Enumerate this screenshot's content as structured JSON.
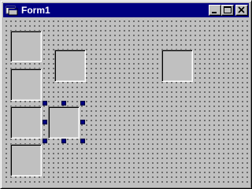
{
  "window": {
    "title": "Form1",
    "icon": "form-icon",
    "caption_buttons": [
      "minimize-icon",
      "maximize-icon",
      "close-icon"
    ]
  },
  "designer": {
    "grid": "dotted",
    "controls_count": 7,
    "selected_control": "frame-selected"
  },
  "colors": {
    "title_bar": "#000080",
    "face": "#c0c0c0",
    "selection_handle": "#000080"
  }
}
